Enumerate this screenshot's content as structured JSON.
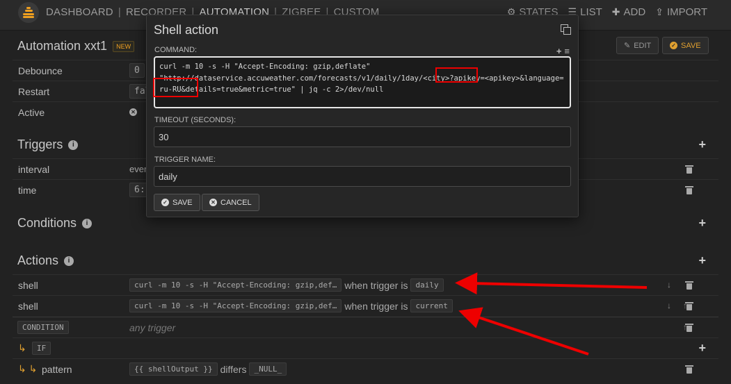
{
  "nav": {
    "links": [
      "DASHBOARD",
      "RECORDER",
      "AUTOMATION",
      "ZIGBEE",
      "CUSTOM"
    ],
    "right": [
      {
        "icon": "gear-icon",
        "label": "STATES"
      },
      {
        "icon": "list-icon",
        "label": "LIST"
      },
      {
        "icon": "plus-icon",
        "label": "ADD"
      },
      {
        "icon": "upload-icon",
        "label": "IMPORT"
      }
    ]
  },
  "header": {
    "title": "Automation xxt1",
    "badge": "NEW",
    "edit_label": "EDIT",
    "save_label": "SAVE"
  },
  "settings": [
    {
      "label": "Debounce",
      "value": "0"
    },
    {
      "label": "Restart",
      "value": "false"
    },
    {
      "label": "Active",
      "value": ""
    }
  ],
  "triggers": {
    "title": "Triggers",
    "rows": [
      {
        "label": "interval",
        "value": "every"
      },
      {
        "label": "time",
        "value": "6:"
      }
    ]
  },
  "conditions": {
    "title": "Conditions"
  },
  "actions": {
    "title": "Actions",
    "rows": [
      {
        "label": "shell",
        "cmd": "curl -m 10 -s -H \"Accept-Encoding: gzip,def…",
        "when": "when trigger is",
        "trigger": "daily"
      },
      {
        "label": "shell",
        "cmd": "curl -m 10 -s -H \"Accept-Encoding: gzip,def…",
        "when": "when trigger is",
        "trigger": "current"
      }
    ],
    "condition_chip": "CONDITION",
    "condition_text": "any trigger",
    "if_chip": "IF",
    "pattern_label": "pattern",
    "pattern_value": "{{ shellOutput }}",
    "pattern_op": "differs",
    "pattern_null": "_NULL_"
  },
  "modal": {
    "title": "Shell action",
    "command_label": "COMMAND:",
    "command": "curl -m 10 -s -H \"Accept-Encoding: gzip,deflate\"\n\"http://dataservice.accuweather.com/forecasts/v1/daily/1day/<city>?apikey=<apikey>&language=ru-RU&details=true&metric=true\" | jq -c 2>/dev/null",
    "timeout_label": "TIMEOUT (SECONDS):",
    "timeout_value": "30",
    "trigger_name_label": "TRIGGER NAME:",
    "trigger_name_value": "daily",
    "save_label": "SAVE",
    "cancel_label": "CANCEL"
  },
  "colors": {
    "accent": "#f0a020",
    "annotation": "#ee0000"
  }
}
